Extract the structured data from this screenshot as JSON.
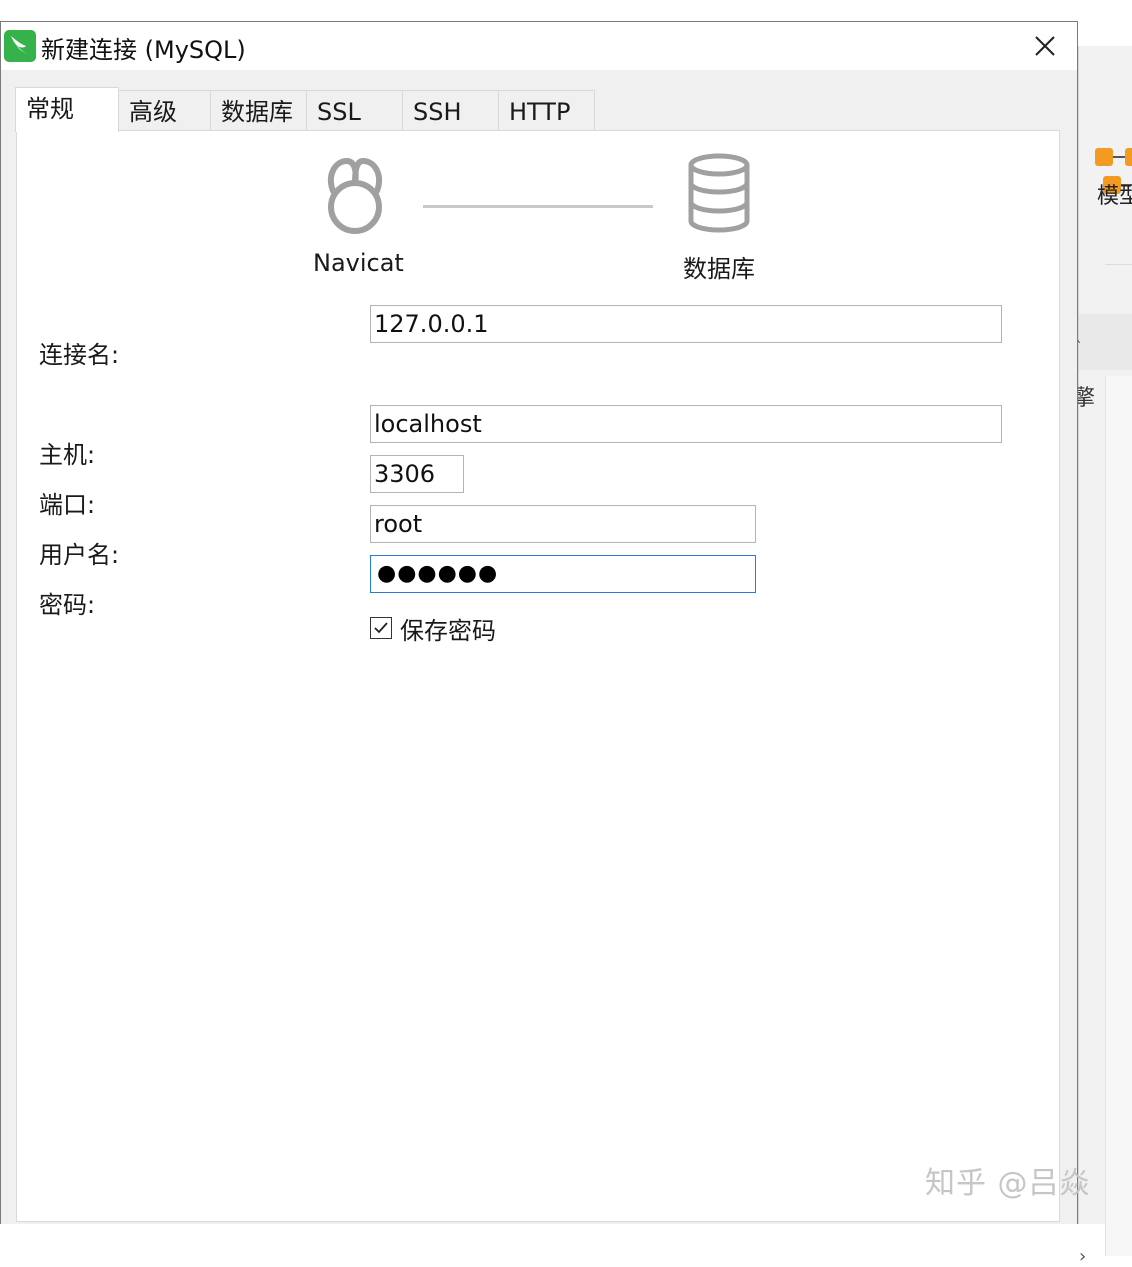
{
  "window": {
    "title": "新建连接 (MySQL)"
  },
  "tabs": [
    {
      "label": "常规",
      "active": true
    },
    {
      "label": "高级",
      "active": false
    },
    {
      "label": "数据库",
      "active": false
    },
    {
      "label": "SSL",
      "active": false
    },
    {
      "label": "SSH",
      "active": false
    },
    {
      "label": "HTTP",
      "active": false
    }
  ],
  "diagram": {
    "left_caption": "Navicat",
    "right_caption": "数据库"
  },
  "form": {
    "connection_name": {
      "label": "连接名:",
      "value": "127.0.0.1"
    },
    "host": {
      "label": "主机:",
      "value": "localhost"
    },
    "port": {
      "label": "端口:",
      "value": "3306"
    },
    "username": {
      "label": "用户名:",
      "value": "root"
    },
    "password": {
      "label": "密码:",
      "masked": "●●●●●●"
    },
    "save_password": {
      "label": "保存密码",
      "checked": true
    }
  },
  "background_app": {
    "model_label": "模型",
    "partial_char": "擎"
  },
  "watermark": "知乎 @吕焱",
  "colors": {
    "app_icon_green": "#35b24a",
    "model_icon_orange": "#f29a22",
    "focus_border": "#2b7bd3"
  }
}
